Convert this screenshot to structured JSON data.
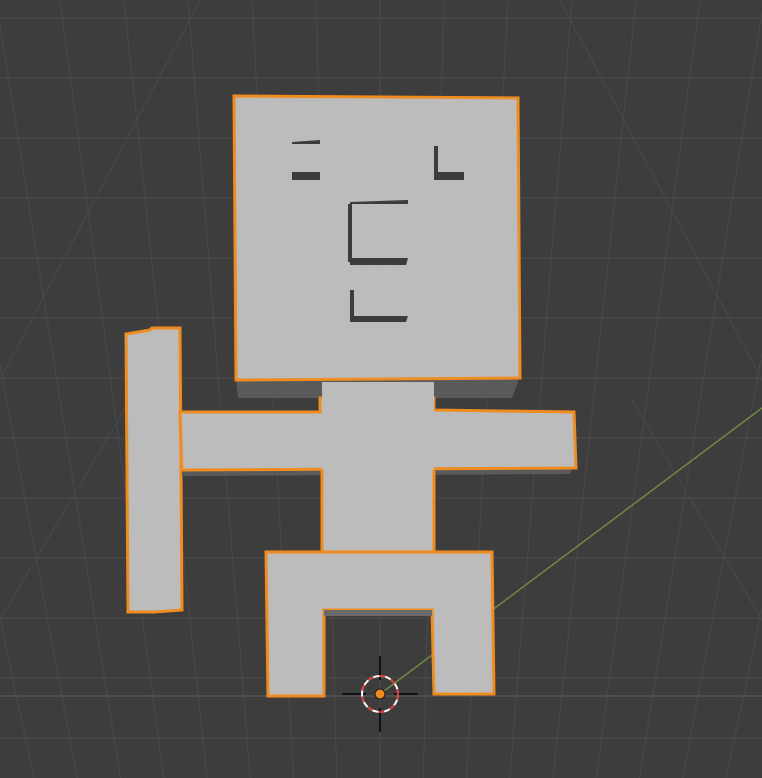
{
  "viewport": {
    "background": "#3d3d3d",
    "grid_color": "#4a4a4a",
    "horizon_color": "#4f4f4f",
    "y_axis_color": "#6f8a3a"
  },
  "scene": {
    "object_type": "character-mesh",
    "selected": true,
    "mesh_color": "#bcbcbc",
    "shadow_color": "#5a5a5a",
    "selection_outline_color": "#f08b1e",
    "face_feature_color": "#3c3c3c"
  },
  "cursor_3d": {
    "icon": "3d-cursor-icon",
    "ring_colors": [
      "#ffffff",
      "#d83a3a"
    ],
    "crosshair_color": "#111111"
  },
  "origin": {
    "icon": "object-origin-icon",
    "color": "#f08b1e"
  }
}
